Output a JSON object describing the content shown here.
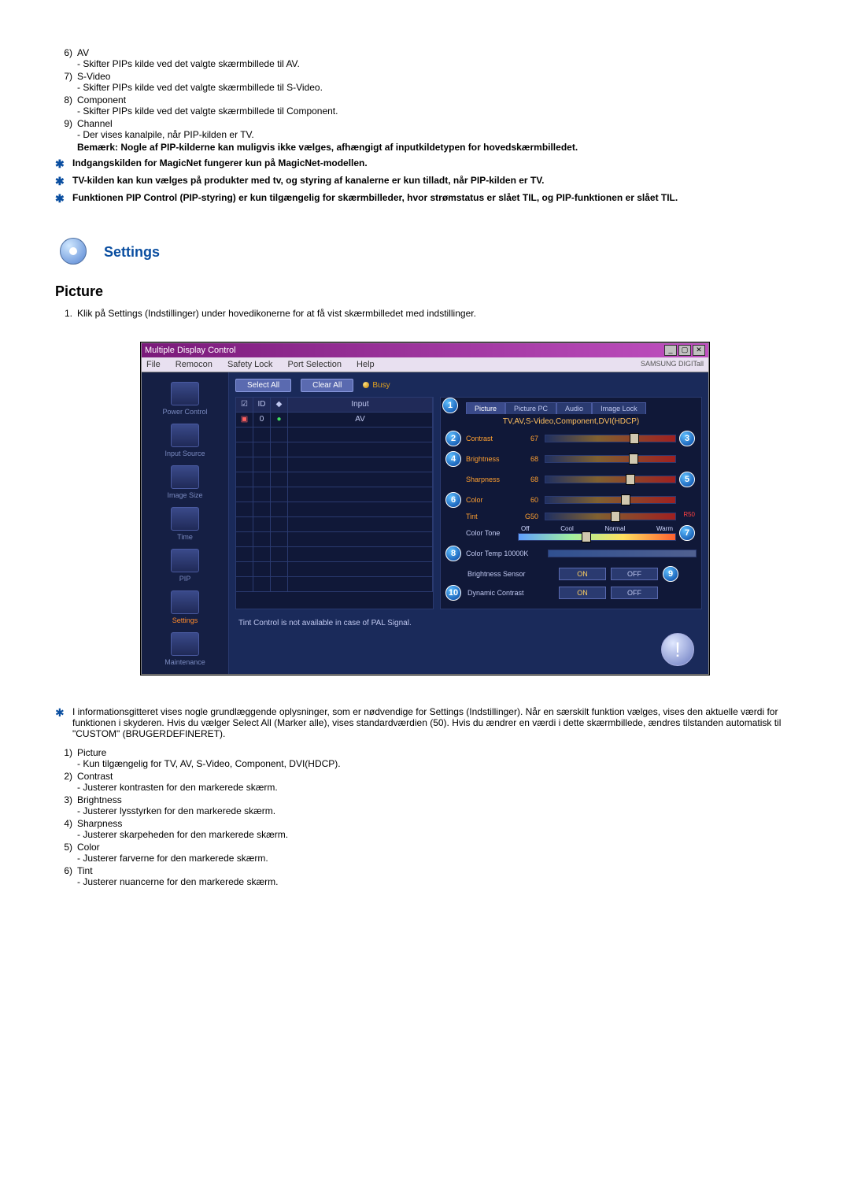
{
  "top_list": [
    {
      "n": "6)",
      "title": "AV",
      "desc": "- Skifter PIPs kilde ved det valgte skærmbillede til AV."
    },
    {
      "n": "7)",
      "title": "S-Video",
      "desc": "- Skifter PIPs kilde ved det valgte skærmbillede til S-Video."
    },
    {
      "n": "8)",
      "title": "Component",
      "desc": "- Skifter PIPs kilde ved det valgte skærmbillede til Component."
    },
    {
      "n": "9)",
      "title": "Channel",
      "desc": "- Der vises kanalpile, når PIP-kilden er TV."
    }
  ],
  "remark": "Bemærk: Nogle af PIP-kilderne kan muligvis ikke vælges, afhængigt af inputkildetypen for hovedskærmbilledet.",
  "stars": [
    "Indgangskilden for MagicNet fungerer kun på MagicNet-modellen.",
    "TV-kilden kan kun vælges på produkter med tv, og styring af kanalerne er kun tilladt, når PIP-kilden er TV.",
    "Funktionen PIP Control (PIP-styring) er kun tilgængelig for skærmbilleder, hvor strømstatus er slået TIL, og PIP-funktionen er slået TIL."
  ],
  "section_title": "Settings",
  "sub_title": "Picture",
  "intro_n": "1.",
  "intro": "Klik på Settings (Indstillinger) under hovedikonerne for at få vist skærmbilledet med indstillinger.",
  "ss": {
    "window_title": "Multiple Display Control",
    "brand": "SAMSUNG DIGITall",
    "menus": [
      "File",
      "Remocon",
      "Safety Lock",
      "Port Selection",
      "Help"
    ],
    "sidebar": [
      {
        "label": "Power Control"
      },
      {
        "label": "Input Source"
      },
      {
        "label": "Image Size"
      },
      {
        "label": "Time"
      },
      {
        "label": "PIP"
      },
      {
        "label": "Settings"
      },
      {
        "label": "Maintenance"
      }
    ],
    "select_all": "Select All",
    "clear_all": "Clear All",
    "busy": "Busy",
    "table": {
      "headers": [
        "",
        "ID",
        "",
        "Input"
      ],
      "row0": [
        "",
        "0",
        "",
        "AV"
      ]
    },
    "tabs": [
      "Picture",
      "Picture PC",
      "Audio",
      "Image Lock"
    ],
    "mode": "TV,AV,S-Video,Component,DVI(HDCP)",
    "sliders": [
      {
        "b": "2",
        "name": "Contrast",
        "val": "67",
        "rb": "3",
        "pos": 65
      },
      {
        "b": "4",
        "name": "Brightness",
        "val": "68",
        "rb": "",
        "pos": 64
      },
      {
        "b": "",
        "name": "Sharpness",
        "val": "68",
        "rb": "5",
        "pos": 62
      },
      {
        "b": "6",
        "name": "Color",
        "val": "60",
        "rb": "",
        "pos": 58
      },
      {
        "b": "",
        "name": "Tint",
        "val": "G50",
        "rb": "",
        "pos": 50,
        "rtext": "R50"
      }
    ],
    "tone": {
      "name": "Color Tone",
      "labels": [
        "Off",
        "Cool",
        "Normal",
        "Warm"
      ],
      "b": "7",
      "pos": 40
    },
    "ct": {
      "b": "8",
      "label": "Color Temp 10000K"
    },
    "onoff": [
      {
        "b": "",
        "label": "Brightness Sensor",
        "on": "ON",
        "off": "OFF",
        "rb": "9"
      },
      {
        "b": "10",
        "label": "Dynamic Contrast",
        "on": "ON",
        "off": "OFF",
        "rb": ""
      }
    ],
    "footnote": "Tint Control is not available in case of PAL Signal.",
    "bubble1": "1"
  },
  "info_star": "I informationsgitteret vises nogle grundlæggende oplysninger, som er nødvendige for Settings (Indstillinger). Når en særskilt funktion vælges, vises den aktuelle værdi for funktionen i skyderen. Hvis du vælger Select All (Marker alle), vises standardværdien (50). Hvis du ændrer en værdi i dette skærmbillede, ændres tilstanden automatisk til \"CUSTOM\" (BRUGERDEFINERET).",
  "bottom_list": [
    {
      "n": "1)",
      "title": "Picture",
      "desc": "- Kun tilgængelig for TV, AV, S-Video, Component, DVI(HDCP)."
    },
    {
      "n": "2)",
      "title": "Contrast",
      "desc": "- Justerer kontrasten for den markerede skærm."
    },
    {
      "n": "3)",
      "title": "Brightness",
      "desc": "- Justerer lysstyrken for den markerede skærm."
    },
    {
      "n": "4)",
      "title": "Sharpness",
      "desc": "- Justerer skarpeheden for den markerede skærm."
    },
    {
      "n": "5)",
      "title": "Color",
      "desc": "- Justerer farverne for den markerede skærm."
    },
    {
      "n": "6)",
      "title": "Tint",
      "desc": "- Justerer nuancerne for den markerede skærm."
    }
  ]
}
